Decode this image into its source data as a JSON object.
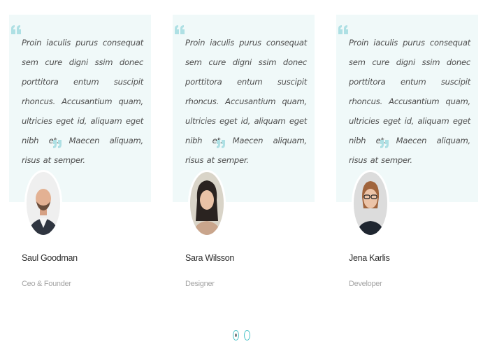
{
  "testimonials": [
    {
      "quote": "Proin iaculis purus consequat sem cure digni ssim donec porttitora entum suscipit rhoncus. Accusantium quam, ultricies eget id, aliquam eget nibh et. Maecen aliquam, risus at semper.",
      "name": "Saul Goodman",
      "role": "Ceo & Founder"
    },
    {
      "quote": "Proin iaculis purus consequat sem cure digni ssim donec porttitora entum suscipit rhoncus. Accusantium quam, ultricies eget id, aliquam eget nibh et. Maecen aliquam, risus at semper.",
      "name": "Sara Wilsson",
      "role": "Designer"
    },
    {
      "quote": "Proin iaculis purus consequat sem cure digni ssim donec porttitora entum suscipit rhoncus. Accusantium quam, ultricies eget id, aliquam eget nibh et. Maecen aliquam, risus at semper.",
      "name": "Jena Karlis",
      "role": "Developer"
    }
  ],
  "pagination": {
    "pages": 2,
    "active_page": 1
  },
  "colors": {
    "accent": "#45c0c6",
    "quote_background": "#f0f9f9",
    "quote_icon": "#aee0e4"
  },
  "icons": {
    "quote_open": "quote-left-icon",
    "quote_close": "quote-right-icon"
  }
}
